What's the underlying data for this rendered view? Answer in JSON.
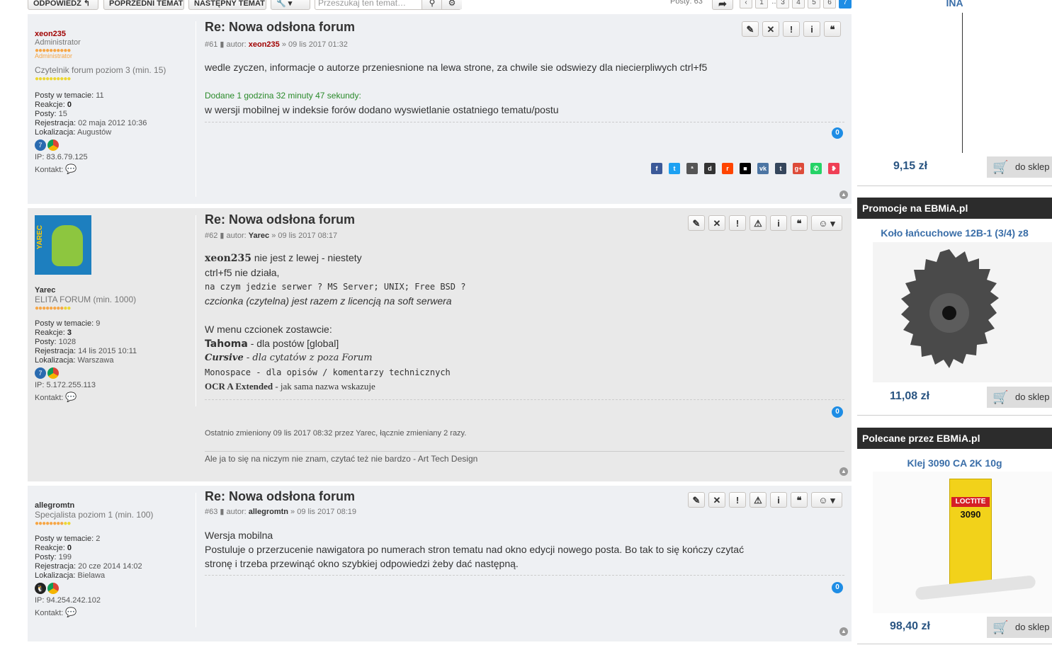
{
  "toolbar": {
    "reply": "ODPOWIEDZ",
    "prev_topic": "POPRZEDNI TEMAT",
    "next_topic": "NASTĘPNY TEMAT",
    "search_placeholder": "Przeszukaj ten temat…",
    "post_count": "Posty: 63",
    "pages": [
      "1",
      "…",
      "3",
      "4",
      "5",
      "6",
      "7"
    ],
    "active_page": "7"
  },
  "posts": [
    {
      "title": "Re: Nowa odsłona forum",
      "number": "#61",
      "author_label": "autor:",
      "author": "xeon235",
      "date": "» 09 lis 2017 01:32",
      "body": [
        "wedle zyczen, informacje o autorze przeniesnione na lewa strone, za chwile sie odswiezy dla niecierpliwych ctrl+f5"
      ],
      "added_note": "Dodane 1 godzina 32 minuty 47 sekundy:",
      "body2": "w wersji mobilnej w indeksie forów dodano wyswietlanie ostatniego tematu/postu",
      "likes": "0",
      "profile": {
        "username": "xeon235",
        "rank": "Administrator",
        "rank_sub": "Administrator",
        "level": "Czytelnik forum poziom 3 (min. 15)",
        "posts_in_topic_label": "Posty w temacie:",
        "posts_in_topic": "11",
        "reactions_label": "Reakcje:",
        "reactions": "0",
        "posts_label": "Posty:",
        "posts": "15",
        "reg_label": "Rejestracja:",
        "reg": "02 maja 2012 10:36",
        "loc_label": "Lokalizacja:",
        "loc": "Augustów",
        "ip": "IP: 83.6.79.125",
        "contact": "Kontakt:"
      }
    },
    {
      "title": "Re: Nowa odsłona forum",
      "number": "#62",
      "author_label": "autor:",
      "author": "Yarec",
      "date": "» 09 lis 2017 08:17",
      "line1a": "xeon235",
      "line1b": " nie jest z lewej - niestety",
      "line2": "ctrl+f5 nie działa,",
      "line3": "na czym jedzie serwer ? MS Server; UNIX; Free BSD ?",
      "line4": "czcionka (czytelna) jest razem z licencją na soft serwera",
      "line5": "W menu czcionek zostawcie:",
      "f1a": "Tahoma",
      "f1b": " - dla postów [global]",
      "f2a": "Cursive",
      "f2b": " - dla cytatów z poza Forum",
      "f3": "Monospace - dla opisów / komentarzy technicznych",
      "f4a": "OCR A Extended",
      "f4b": " - jak sama nazwa wskazuje",
      "likes": "0",
      "edit_note": "Ostatnio zmieniony 09 lis 2017 08:32 przez Yarec, łącznie zmieniany 2 razy.",
      "signature": "Ale ja to się na niczym nie znam, czytać też nie bardzo - Art Tech Design",
      "avatar_text": "YAREC",
      "profile": {
        "username": "Yarec",
        "rank": "ELITA FORUM (min. 1000)",
        "posts_in_topic_label": "Posty w temacie:",
        "posts_in_topic": "9",
        "reactions_label": "Reakcje:",
        "reactions": "3",
        "posts_label": "Posty:",
        "posts": "1028",
        "reg_label": "Rejestracja:",
        "reg": "14 lis 2015 10:11",
        "loc_label": "Lokalizacja:",
        "loc": "Warszawa",
        "ip": "IP: 5.172.255.113",
        "contact": "Kontakt:"
      }
    },
    {
      "title": "Re: Nowa odsłona forum",
      "number": "#63",
      "author_label": "autor:",
      "author": "allegromtn",
      "date": "» 09 lis 2017 08:19",
      "line1": "Wersja mobilna",
      "line2": "Postuluje o przerzucenie nawigatora po numerach stron tematu nad okno edycji nowego posta. Bo tak to się kończy czytać",
      "line3": "stronę i trzeba przewinąć okno szybkiej odpowiedzi żeby dać następną.",
      "likes": "0",
      "profile": {
        "username": "allegromtn",
        "rank": "Specjalista poziom 1 (min. 100)",
        "posts_in_topic_label": "Posty w temacie:",
        "posts_in_topic": "2",
        "reactions_label": "Reakcje:",
        "reactions": "0",
        "posts_label": "Posty:",
        "posts": "199",
        "reg_label": "Rejestracja:",
        "reg": "20 cze 2014 14:02",
        "loc_label": "Lokalizacja:",
        "loc": "Bielawa",
        "ip": "IP: 94.254.242.102",
        "contact": "Kontakt:"
      }
    }
  ],
  "sidebar": {
    "top_product": "INA",
    "top_price": "9,15 zł",
    "cart_label": "do sklep",
    "section1": "Promocje na EBMiA.pl",
    "product1": "Koło łańcuchowe 12B-1 (3/4) z8",
    "price1": "11,08 zł",
    "section2": "Polecane przez EBMiA.pl",
    "product2": "Klej 3090 CA 2K 10g",
    "price2": "98,40 zł",
    "glue_brand": "LOCTITE",
    "glue_code": "3090"
  }
}
